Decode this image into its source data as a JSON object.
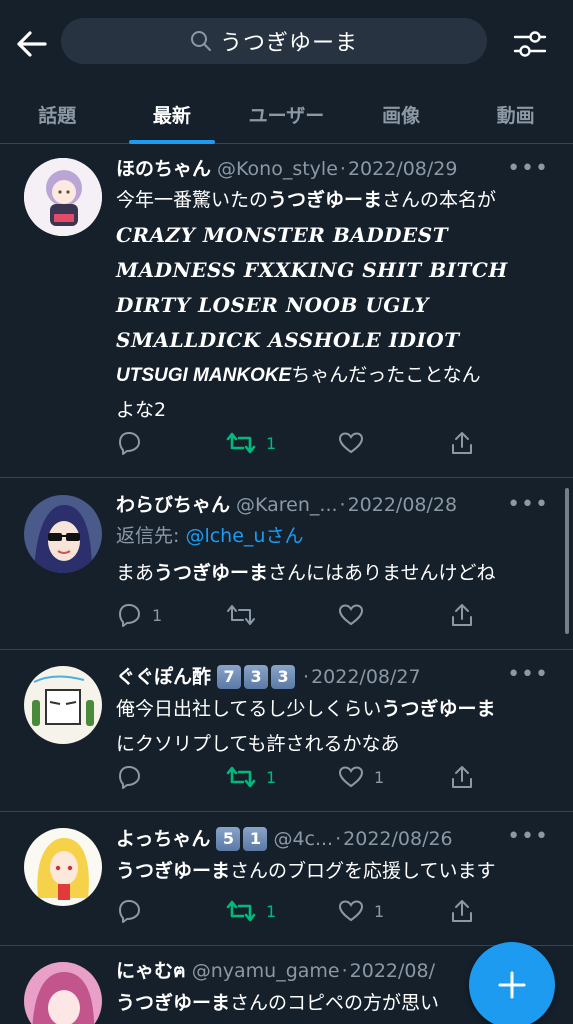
{
  "search": {
    "query": "うつぎゆーま"
  },
  "tabs": [
    {
      "label": "話題",
      "active": false
    },
    {
      "label": "最新",
      "active": true
    },
    {
      "label": "ユーザー",
      "active": false
    },
    {
      "label": "画像",
      "active": false
    },
    {
      "label": "動画",
      "active": false
    }
  ],
  "colors": {
    "background": "#15202b",
    "accent": "#1d9bf0",
    "retweet_active": "#00ba7c",
    "muted": "#8b98a5"
  },
  "tweets": [
    {
      "name": "ほのちゃん",
      "handle": "@Kono_style",
      "date": "2022/08/29",
      "text_line1_pre": "今年一番驚いたの",
      "text_line1_bold": "うつぎゆーま",
      "text_line1_post": "さんの本名が",
      "italic_lines": [
        "CRAZY MONSTER BADDEST",
        "MADNESS FXXKING SHIT BITCH",
        "DIRTY LOSER NOOB UGLY",
        "SMALLDICK ASSHOLE IDIOT"
      ],
      "text_last_bold": "UTSUGI MANKOKE",
      "text_last_post": "ちゃんだったことなん",
      "text_tail": "よな2",
      "reply_count": "",
      "retweet_count": "1",
      "like_count": ""
    },
    {
      "name": "わらびちゃん",
      "handle": "@Karen_...",
      "date": "2022/08/28",
      "reply_prefix": "返信先: ",
      "reply_mention": "@lche_u",
      "reply_suffix": "さん",
      "text_pre": "まあ",
      "text_bold": "うつぎゆーま",
      "text_post": "さんにはありませんけどね",
      "reply_count": "1",
      "retweet_count": "",
      "like_count": ""
    },
    {
      "name": "ぐぐぽん酢",
      "badges": [
        "7",
        "3",
        "3"
      ],
      "handle": "",
      "date": "2022/08/27",
      "text_pre": "俺今日出社してるし少しくらい",
      "text_bold": "うつぎゆーま",
      "text_line2": "にクソリプしても許されるかなあ",
      "reply_count": "",
      "retweet_count": "1",
      "like_count": "1"
    },
    {
      "name": "よっちゃん",
      "badges": [
        "5",
        "1"
      ],
      "handle": "@4c...",
      "date": "2022/08/26",
      "text_bold": "うつぎゆーま",
      "text_post": "さんのブログを応援しています",
      "reply_count": "",
      "retweet_count": "1",
      "like_count": "1"
    },
    {
      "name": "にゃむ",
      "name_suffix": "ฅ",
      "handle": "@nyamu_game",
      "date": "2022/08/",
      "text_bold": "うつぎゆーま",
      "text_post": "さんのコピペの方が思い"
    }
  ],
  "icons": {
    "back": "arrow-left-icon",
    "filter": "sliders-icon",
    "search": "search-icon",
    "reply": "reply-icon",
    "retweet": "retweet-icon",
    "like": "heart-icon",
    "share": "share-icon",
    "compose": "plus-icon"
  }
}
